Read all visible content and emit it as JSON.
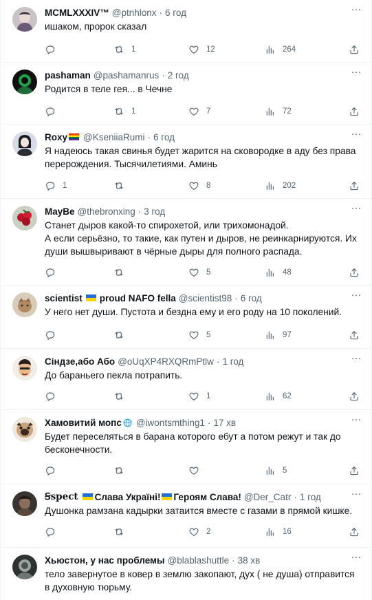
{
  "colors": {
    "text": "#0f1419",
    "muted": "#536471",
    "border": "#eff3f4",
    "ua_blue": "#1f6fd6",
    "ua_yellow": "#ffd500"
  },
  "icons": {
    "reply": "reply-icon",
    "retweet": "retweet-icon",
    "like": "heart-icon",
    "views": "views-icon",
    "share": "share-icon",
    "more": "more-icon"
  },
  "tweets": [
    {
      "name": "MCMLXXXIV™",
      "handle": "@ptnhlonx",
      "sep": "·",
      "time": "6 год",
      "text": "ишаком, пророк сказал",
      "replies": "",
      "retweets": "1",
      "likes": "12",
      "views": "264"
    },
    {
      "name": "pashaman",
      "handle": "@pashamanrus",
      "sep": "·",
      "time": "2 год",
      "text": "Родится в теле гея... в Чечне",
      "replies": "",
      "retweets": "1",
      "likes": "7",
      "views": "72"
    },
    {
      "name": "Roxy",
      "handle": "@KseniiaRumi",
      "sep": "·",
      "time": "6 год",
      "text": "Я надеюсь такая свинья будет жарится на сковородке в аду без права перерождения. Тысячилетиями. Аминь",
      "replies": "1",
      "retweets": "",
      "likes": "8",
      "views": "202"
    },
    {
      "name": "MayBe",
      "handle": "@thebronxing",
      "sep": "·",
      "time": "3 год",
      "text": "Станет дыров какой-то спирохетой, или трихомонадой.\nА если серьёзно,  то такие, как путен и дыров, не реинкарнируются. Их души вышвыривают в чёрные дыры для полного распада.",
      "replies": "",
      "retweets": "",
      "likes": "5",
      "views": "48"
    },
    {
      "name_a": "scientist",
      "name_b": "proud NAFO fella",
      "handle": "@scientist98",
      "sep": "·",
      "time": "6 год",
      "text": "У него нет души. Пустота и бездна ему и его роду на 10 поколений.",
      "replies": "",
      "retweets": "",
      "likes": "5",
      "views": "97"
    },
    {
      "name": "Сіндзе,або Або",
      "handle": "@oUqXP4RXQRmPtlw",
      "sep": "·",
      "time": "1 год",
      "text": "До бараньего пекла потрапить.",
      "replies": "",
      "retweets": "",
      "likes": "1",
      "views": "62"
    },
    {
      "name": "Хамовитий мопс",
      "handle": "@iwontsmthing1",
      "sep": "·",
      "time": "17 хв",
      "text": "Будет переселяться в барана которого ебут а потом режут и так до бесконечности.",
      "replies": "",
      "retweets": "",
      "likes": "",
      "views": "5"
    },
    {
      "name_a": "Ꞩspect",
      "name_b": "Слава Україні!",
      "name_c": "Героям Слава!",
      "handle": "@Der_Catr",
      "sep": "·",
      "time": "1 год",
      "text": "Душонка рамзана кадырки затаится вместе с газами в прямой кишке.",
      "replies": "",
      "retweets": "",
      "likes": "2",
      "views": "16"
    },
    {
      "name": "Хьюстон, у нас проблемы",
      "handle": "@blablashuttle",
      "sep": "·",
      "time": "38 хв",
      "text": "тело завернутое в ковер в землю закопают, дух ( не душа) отправится в духовную тюрьму."
    }
  ]
}
